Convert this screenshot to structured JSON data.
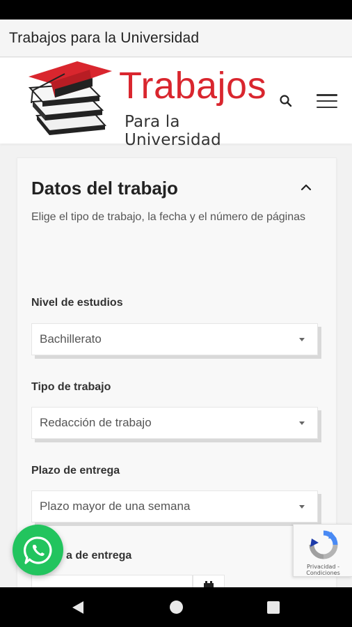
{
  "app_bar": {
    "title": "Trabajos para la Universidad"
  },
  "header": {
    "logo_word": "Trabajos",
    "logo_sub": "Para la Universidad",
    "search_icon": "search-icon",
    "menu_icon": "hamburger-menu-icon"
  },
  "form": {
    "title": "Datos del trabajo",
    "description": "Elige el tipo de trabajo, la fecha y el número de páginas",
    "collapse_icon": "chevron-up-icon",
    "fields": [
      {
        "label": "Nivel de estudios",
        "value": "Bachillerato"
      },
      {
        "label": "Tipo de trabajo",
        "value": "Redacción de trabajo"
      },
      {
        "label": "Plazo de entrega",
        "value": "Plazo mayor de una semana"
      },
      {
        "label": "Fecha de entrega",
        "visible_label": "a de entrega"
      }
    ],
    "date_picker_icon": "calendar-icon"
  },
  "whatsapp": {
    "icon": "whatsapp-icon"
  },
  "recaptcha": {
    "line1": "Privacidad -",
    "line2": "Condiciones"
  },
  "nav_bar": {
    "back_icon": "back-triangle-icon",
    "home_icon": "home-circle-icon",
    "recents_icon": "recents-square-icon"
  },
  "colors": {
    "brand_red": "#d9262e",
    "whatsapp_green": "#22c45e"
  }
}
